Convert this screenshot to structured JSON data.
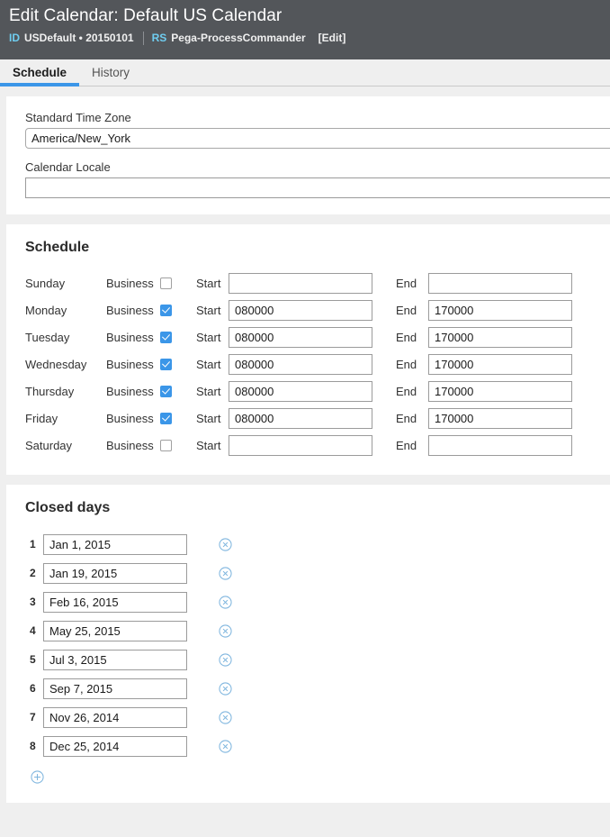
{
  "header": {
    "title": "Edit Calendar: Default US Calendar",
    "id_key": "ID",
    "id_value": "USDefault • 20150101",
    "rs_key": "RS",
    "rs_value": "Pega-ProcessCommander",
    "edit_link": "[Edit]"
  },
  "tabs": [
    {
      "label": "Schedule",
      "active": true
    },
    {
      "label": "History",
      "active": false
    }
  ],
  "form": {
    "timezone_label": "Standard Time Zone",
    "timezone_value": "America/New_York",
    "locale_label": "Calendar Locale",
    "locale_value": ""
  },
  "schedule": {
    "title": "Schedule",
    "business_label": "Business",
    "start_label": "Start",
    "end_label": "End",
    "rows": [
      {
        "day": "Sunday",
        "business": false,
        "start": "",
        "end": ""
      },
      {
        "day": "Monday",
        "business": true,
        "start": "080000",
        "end": "170000"
      },
      {
        "day": "Tuesday",
        "business": true,
        "start": "080000",
        "end": "170000"
      },
      {
        "day": "Wednesday",
        "business": true,
        "start": "080000",
        "end": "170000"
      },
      {
        "day": "Thursday",
        "business": true,
        "start": "080000",
        "end": "170000"
      },
      {
        "day": "Friday",
        "business": true,
        "start": "080000",
        "end": "170000"
      },
      {
        "day": "Saturday",
        "business": false,
        "start": "",
        "end": ""
      }
    ]
  },
  "closed_days": {
    "title": "Closed days",
    "rows": [
      {
        "num": "1",
        "date": "Jan 1, 2015"
      },
      {
        "num": "2",
        "date": "Jan 19, 2015"
      },
      {
        "num": "3",
        "date": "Feb 16, 2015"
      },
      {
        "num": "4",
        "date": "May 25, 2015"
      },
      {
        "num": "5",
        "date": "Jul 3, 2015"
      },
      {
        "num": "6",
        "date": "Sep 7, 2015"
      },
      {
        "num": "7",
        "date": "Nov 26, 2014"
      },
      {
        "num": "8",
        "date": "Dec 25, 2014"
      }
    ],
    "delete_icon": "remove-circle-icon",
    "add_icon": "add-circle-icon"
  },
  "colors": {
    "header_bg": "#53565a",
    "accent": "#3b96e8",
    "meta_key": "#6fcdf0",
    "icon_blue": "#7eb5de",
    "page_bg": "#efefef"
  }
}
